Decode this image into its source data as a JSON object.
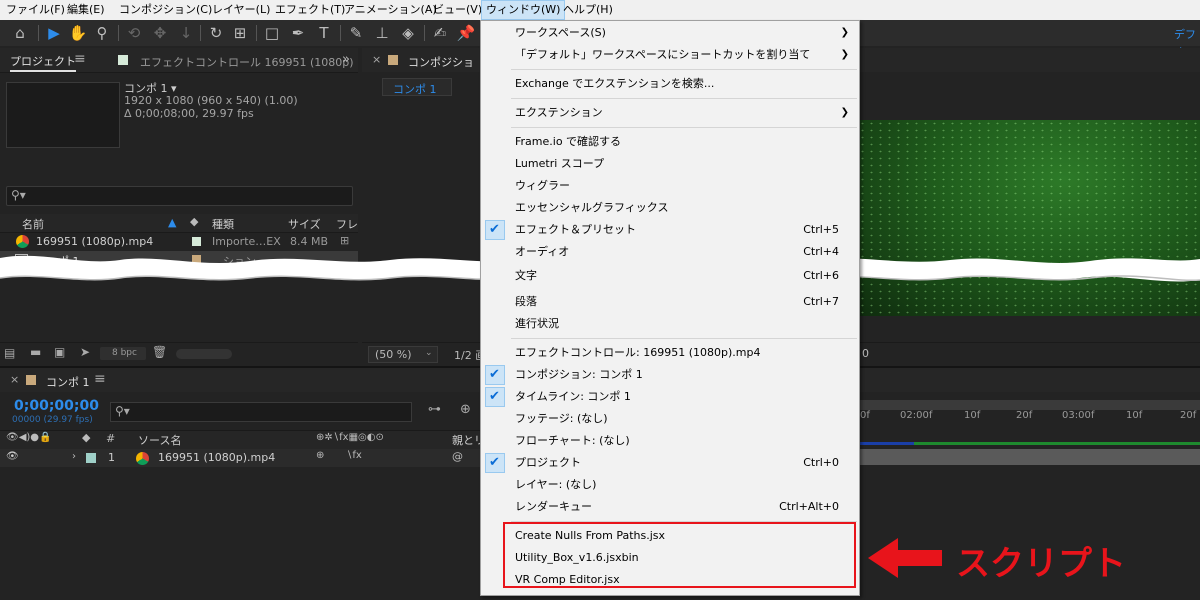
{
  "menubar": {
    "items": [
      "ファイル(F)",
      "編集(E)",
      "コンポジション(C)",
      "レイヤー(L)",
      "エフェクト(T)",
      "アニメーション(A)",
      "ビュー(V)",
      "ウィンドウ(W)",
      "ヘルプ(H)"
    ],
    "active_index": 7
  },
  "toolbar": {
    "right_label": "デフォ"
  },
  "project_panel": {
    "tab_label": "プロジェクト",
    "effect_control_tab": "エフェクトコントロール 169951 (1080p)",
    "comp_name": "コンポ 1 ▾",
    "comp_info_line1": "1920 x 1080  (960 x 540) (1.00)",
    "comp_info_line2": "Δ 0;00;08;00, 29.97 fps",
    "search_icon": "search-icon",
    "columns": [
      "名前",
      "種類",
      "サイズ",
      "フレ"
    ],
    "rows": [
      {
        "name": "169951 (1080p).mp4",
        "type": "Importe…EX",
        "size": "8.4 MB"
      },
      {
        "name": "コンポ 1",
        "type": "…ション",
        "size": ""
      }
    ],
    "bpc_label": "8 bpc"
  },
  "composition_panel": {
    "tab_label": "コンポジショ",
    "sub_tab": "コンポ 1",
    "zoom_value": "(50 %)",
    "resolution_value": "1/2 画",
    "right_value": "0"
  },
  "timeline_panel": {
    "tab_label": "コンポ 1",
    "timecode": "0;00;00;00",
    "frames_fps": "00000 (29.97 fps)",
    "layer_header": "ソース名",
    "parent_header": "親とリ",
    "hash_header": "#",
    "layer_number": "1",
    "layer_name": "169951 (1080p).mp4",
    "ruler_labels": [
      "0f",
      "02:00f",
      "10f",
      "20f",
      "03:00f",
      "10f",
      "20f"
    ]
  },
  "window_menu": {
    "sections": [
      [
        {
          "label": "ワークスペース(S)",
          "submenu": true
        },
        {
          "label": "「デフォルト」ワークスペースにショートカットを割り当て",
          "submenu": true
        }
      ],
      [
        {
          "label": "Exchange でエクステンションを検索..."
        }
      ],
      [
        {
          "label": "エクステンション",
          "submenu": true
        }
      ],
      [
        {
          "label": "Frame.io で確認する"
        },
        {
          "label": "Lumetri スコープ"
        },
        {
          "label": "ウィグラー"
        },
        {
          "label": "エッセンシャルグラフィックス"
        },
        {
          "label": "エフェクト＆プリセット",
          "shortcut": "Ctrl+5",
          "checked": true
        },
        {
          "label": "オーディオ",
          "shortcut": "Ctrl+4"
        },
        {
          "label": "文字",
          "shortcut": "Ctrl+6"
        },
        {
          "label": "段落",
          "shortcut": "Ctrl+7"
        },
        {
          "label": "進行状況"
        }
      ],
      [
        {
          "label": "エフェクトコントロール: 169951 (1080p).mp4"
        },
        {
          "label": "コンポジション: コンポ 1",
          "checked": true
        },
        {
          "label": "タイムライン: コンポ 1",
          "checked": true
        },
        {
          "label": "フッテージ: (なし)"
        },
        {
          "label": "フローチャート: (なし)"
        },
        {
          "label": "プロジェクト",
          "shortcut": "Ctrl+0",
          "checked": true
        },
        {
          "label": "レイヤー: (なし)"
        },
        {
          "label": "レンダーキュー",
          "shortcut": "Ctrl+Alt+0"
        }
      ],
      [
        {
          "label": "Create Nulls From Paths.jsx"
        },
        {
          "label": "Utility_Box_v1.6.jsxbin"
        },
        {
          "label": "VR Comp Editor.jsx"
        }
      ]
    ]
  },
  "annotation": {
    "label": "スクリプト",
    "color": "#e8141b"
  }
}
